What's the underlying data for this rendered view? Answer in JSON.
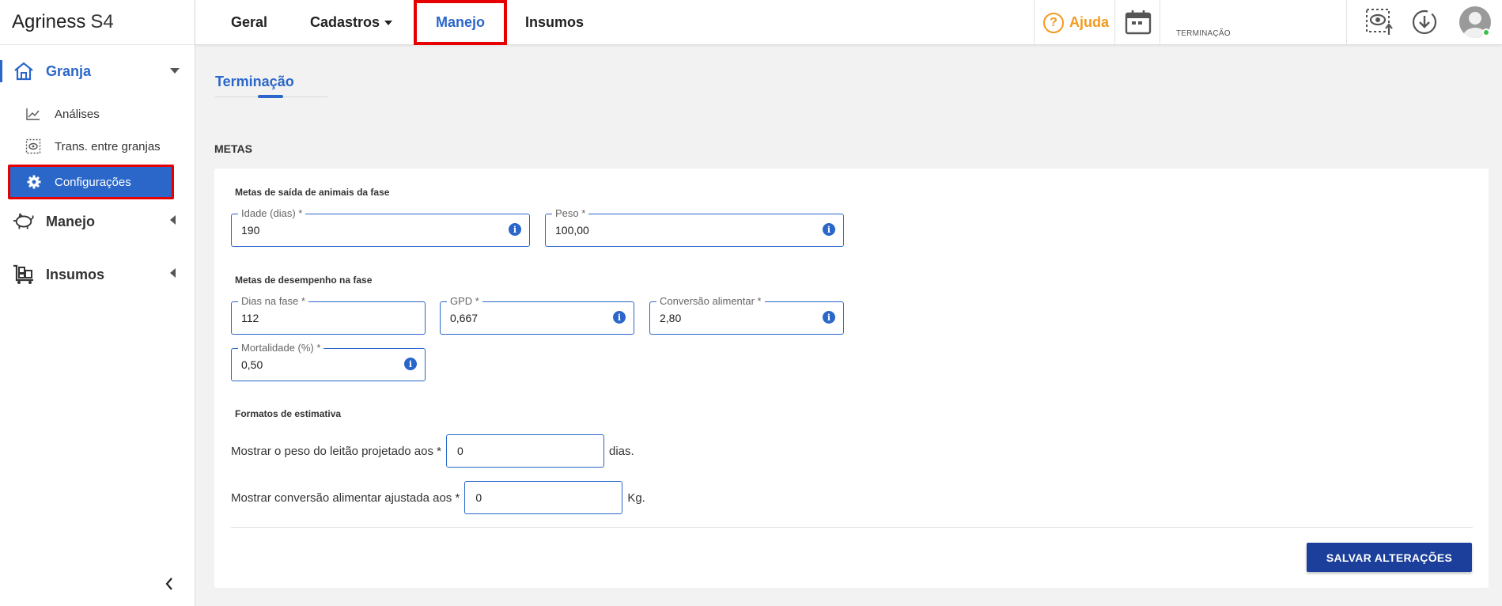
{
  "brand": {
    "name": "Agriness",
    "product": "S4"
  },
  "sidebar": {
    "groups": [
      {
        "label": "Granja",
        "icon": "home-icon",
        "expanded": true
      },
      {
        "label": "Manejo",
        "icon": "pig-icon",
        "expanded": false
      },
      {
        "label": "Insumos",
        "icon": "cart-icon",
        "expanded": false
      }
    ],
    "items": [
      {
        "label": "Análises",
        "icon": "chart-line-icon"
      },
      {
        "label": "Trans. entre granjas",
        "icon": "transfer-icon"
      },
      {
        "label": "Configurações",
        "icon": "gear-icon",
        "active": true
      }
    ]
  },
  "topbar": {
    "tabs": [
      {
        "label": "Geral"
      },
      {
        "label": "Cadastros",
        "dropdown": true
      },
      {
        "label": "Manejo",
        "active": true
      },
      {
        "label": "Insumos"
      }
    ],
    "help_label": "Ajuda",
    "phase": "TERMINAÇÃO"
  },
  "main": {
    "subtab": "Terminação",
    "section_title": "METAS",
    "group1": {
      "title": "Metas de saída de animais da fase",
      "fields": [
        {
          "label": "Idade (dias) *",
          "value": "190"
        },
        {
          "label": "Peso *",
          "value": "100,00"
        }
      ]
    },
    "group2": {
      "title": "Metas de desempenho na fase",
      "fields": [
        {
          "label": "Dias na fase *",
          "value": "112"
        },
        {
          "label": "GPD *",
          "value": "0,667"
        },
        {
          "label": "Conversão alimentar *",
          "value": "2,80"
        },
        {
          "label": "Mortalidade (%) *",
          "value": "0,50"
        }
      ]
    },
    "group3": {
      "title": "Formatos de estimativa",
      "row1": {
        "label": "Mostrar o peso do leitão projetado aos *",
        "value": "0",
        "unit": "dias."
      },
      "row2": {
        "label": "Mostrar conversão alimentar ajustada aos *",
        "value": "0",
        "unit": "Kg."
      }
    },
    "save_label": "SALVAR ALTERAÇÕES"
  },
  "colors": {
    "accent": "#2a67c9",
    "help": "#f39a1e",
    "highlight": "#e60000",
    "save": "#1b3f9a"
  }
}
